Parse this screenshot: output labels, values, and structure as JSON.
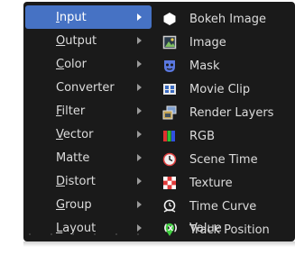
{
  "left_menu": {
    "items": [
      {
        "label": "Input",
        "underline": "I",
        "rest": "nput",
        "active": true
      },
      {
        "label": "Output",
        "underline": "O",
        "rest": "utput",
        "active": false
      },
      {
        "label": "Color",
        "underline": "C",
        "rest": "olor",
        "active": false
      },
      {
        "label": "Converter",
        "underline": "",
        "rest": "Converter",
        "active": false
      },
      {
        "label": "Filter",
        "underline": "F",
        "rest": "ilter",
        "active": false
      },
      {
        "label": "Vector",
        "underline": "V",
        "rest": "ector",
        "active": false
      },
      {
        "label": "Matte",
        "underline": "",
        "rest": "Matte",
        "active": false
      },
      {
        "label": "Distort",
        "underline": "D",
        "rest": "istort",
        "active": false
      },
      {
        "label": "Group",
        "underline": "G",
        "rest": "roup",
        "active": false
      },
      {
        "label": "Layout",
        "underline": "L",
        "rest": "ayout",
        "active": false
      }
    ]
  },
  "submenu": {
    "items": [
      {
        "label": "Bokeh Image",
        "icon": "bokeh-image-icon"
      },
      {
        "label": "Image",
        "icon": "image-icon"
      },
      {
        "label": "Mask",
        "icon": "mask-icon"
      },
      {
        "label": "Movie Clip",
        "icon": "movie-clip-icon"
      },
      {
        "label": "Render Layers",
        "icon": "render-layers-icon"
      },
      {
        "label": "RGB",
        "icon": "rgb-icon"
      },
      {
        "label": "Scene Time",
        "icon": "scene-time-icon"
      },
      {
        "label": "Texture",
        "icon": "texture-icon"
      },
      {
        "label": "Time Curve",
        "icon": "time-curve-icon"
      },
      {
        "label": "Track Position",
        "icon": "track-position-icon"
      },
      {
        "label": "Value",
        "icon": "value-icon",
        "icon_text": "(x)"
      }
    ]
  },
  "colors": {
    "menu_bg": "#1a1a1a",
    "active_bg": "#4672c4",
    "text": "#dcdcdc"
  }
}
